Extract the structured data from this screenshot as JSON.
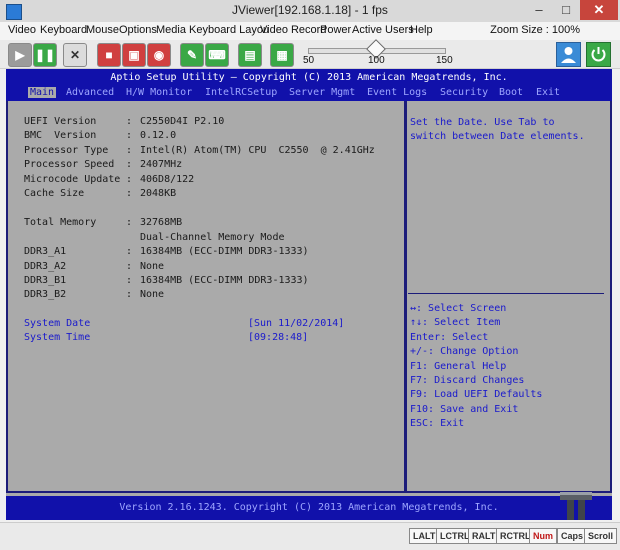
{
  "window": {
    "title": "JViewer[192.168.1.18] - 1 fps",
    "close_glyph": "✕",
    "min_glyph": "–",
    "max_glyph": "□"
  },
  "menu": {
    "items": [
      "Video",
      "Keyboard",
      "Mouse",
      "Options",
      "Media",
      "Keyboard Layou",
      "Video Record",
      "Power",
      "Active Users",
      "Help"
    ],
    "zoom": "Zoom Size : 100%"
  },
  "toolbar": {
    "slider_labels": [
      "50",
      "100",
      "150"
    ],
    "buttons": [
      {
        "icon": "play-icon",
        "color": "#9b9b9b"
      },
      {
        "icon": "pause-icon",
        "color": "#3aa846"
      },
      {
        "icon": "fullscreen-icon",
        "color": "#dcdcdc"
      },
      {
        "icon": "stop-icon",
        "color": "#d04040"
      },
      {
        "icon": "record-icon",
        "color": "#d04040"
      },
      {
        "icon": "disc-icon",
        "color": "#d04040"
      },
      {
        "icon": "mouse-icon",
        "color": "#3aa846"
      },
      {
        "icon": "keyboard-icon",
        "color": "#3aa846"
      },
      {
        "icon": "media-icon",
        "color": "#3aa846"
      },
      {
        "icon": "keyboard-layout-icon",
        "color": "#3aa846"
      }
    ]
  },
  "bios": {
    "title": "Aptio Setup Utility – Copyright (C) 2013 American Megatrends, Inc.",
    "tabs": [
      "Main",
      "Advanced",
      "H/W Monitor",
      "IntelRCSetup",
      "Server Mgmt",
      "Event Logs",
      "Security",
      "Boot",
      "Exit"
    ],
    "info": [
      {
        "label": "UEFI Version",
        "value": "C2550D4I P2.10"
      },
      {
        "label": "BMC  Version",
        "value": "0.12.0"
      },
      {
        "label": "Processor Type",
        "value": "Intel(R) Atom(TM) CPU  C2550  @ 2.41GHz"
      },
      {
        "label": "Processor Speed",
        "value": "2407MHz"
      },
      {
        "label": "Microcode Update",
        "value": "406D8/122"
      },
      {
        "label": "Cache Size",
        "value": "2048KB"
      }
    ],
    "memory": [
      {
        "label": "Total Memory",
        "value": "32768MB"
      },
      {
        "label": "",
        "value": "Dual-Channel Memory Mode"
      },
      {
        "label": "DDR3_A1",
        "value": "16384MB (ECC-DIMM DDR3-1333)"
      },
      {
        "label": "DDR3_A2",
        "value": "None"
      },
      {
        "label": "DDR3_B1",
        "value": "16384MB (ECC-DIMM DDR3-1333)"
      },
      {
        "label": "DDR3_B2",
        "value": "None"
      }
    ],
    "colon": ":",
    "system_date": {
      "label": "System Date",
      "value": "[Sun 11/02/2014]"
    },
    "system_time": {
      "label": "System Time",
      "value": "[09:28:48]"
    },
    "help_lines": [
      "Set the Date. Use Tab to",
      "switch between Date elements."
    ],
    "key_help": [
      "↔: Select Screen",
      "↑↓: Select Item",
      "Enter: Select",
      "+/-: Change Option",
      "F1: General Help",
      "F7: Discard Changes",
      "F9: Load UEFI Defaults",
      "F10: Save and Exit",
      "ESC: Exit"
    ],
    "footer": "Version 2.16.1243. Copyright (C) 2013 American Megatrends, Inc."
  },
  "status_keys": [
    {
      "label": "LALT",
      "active": false
    },
    {
      "label": "LCTRL",
      "active": false
    },
    {
      "label": "RALT",
      "active": false
    },
    {
      "label": "RCTRL",
      "active": false
    },
    {
      "label": "Num",
      "active": true
    },
    {
      "label": "Caps",
      "active": false
    },
    {
      "label": "Scroll",
      "active": false
    }
  ]
}
